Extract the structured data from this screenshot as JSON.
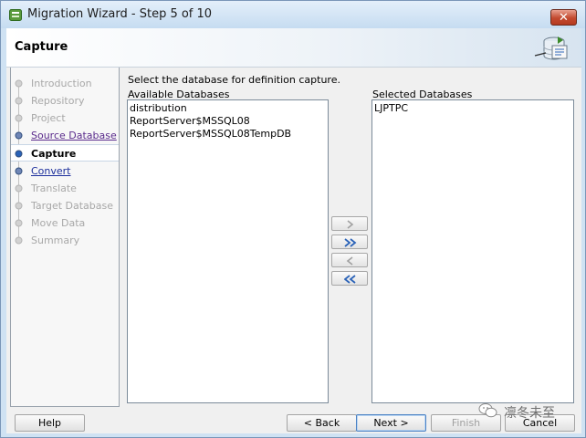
{
  "window": {
    "title": "Migration Wizard - Step 5 of 10",
    "close_label": "✕"
  },
  "header": {
    "title": "Capture"
  },
  "steps": [
    {
      "label": "Introduction",
      "state": "disabled"
    },
    {
      "label": "Repository",
      "state": "disabled"
    },
    {
      "label": "Project",
      "state": "disabled"
    },
    {
      "label": "Source Database",
      "state": "visited"
    },
    {
      "label": "Capture",
      "state": "current"
    },
    {
      "label": "Convert",
      "state": "link"
    },
    {
      "label": "Translate",
      "state": "disabled"
    },
    {
      "label": "Target Database",
      "state": "disabled"
    },
    {
      "label": "Move Data",
      "state": "disabled"
    },
    {
      "label": "Summary",
      "state": "disabled"
    }
  ],
  "main": {
    "prompt": "Select the database for definition capture.",
    "available_label": "Available Databases",
    "available": [
      "distribution",
      "ReportServer$MSSQL08",
      "ReportServer$MSSQL08TempDB"
    ],
    "selected_label": "Selected Databases",
    "selected": [
      "LJPTPC"
    ]
  },
  "move_buttons": [
    "move-right",
    "move-all-right",
    "move-left",
    "move-all-left"
  ],
  "buttons": {
    "help": "Help",
    "back": "< Back",
    "next": "Next >",
    "finish": "Finish",
    "cancel": "Cancel"
  },
  "watermark": {
    "text": "凛冬未至"
  },
  "colors": {
    "accent": "#2b63b8",
    "visited_link": "#5a2b8c",
    "link": "#1c2f9c"
  }
}
